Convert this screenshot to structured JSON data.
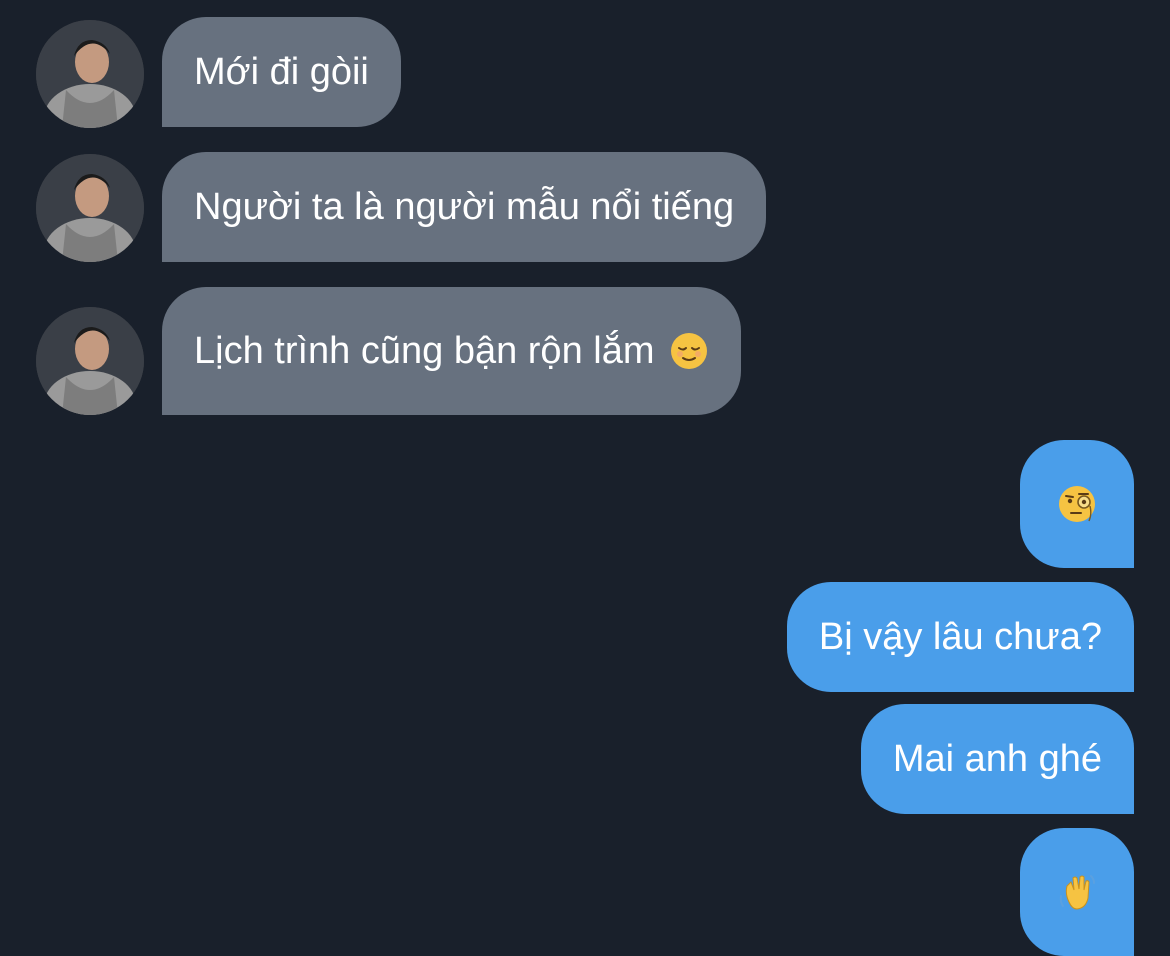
{
  "conversation": {
    "incoming": [
      {
        "text": "Mới đi gòii"
      },
      {
        "text": "Người ta là người mẫu nổi tiếng"
      },
      {
        "text": "Lịch trình cũng bận rộn lắm",
        "emoji": "relieved-face-icon"
      }
    ],
    "outgoing": [
      {
        "emoji": "face-with-monocle-icon"
      },
      {
        "text": "Bị vậy lâu chưa?"
      },
      {
        "text": "Mai anh ghé"
      },
      {
        "emoji": "waving-hand-icon"
      }
    ]
  },
  "colors": {
    "background": "#19202b",
    "incoming_bubble": "#67717f",
    "outgoing_bubble": "#4a9eea",
    "text": "#ffffff"
  }
}
